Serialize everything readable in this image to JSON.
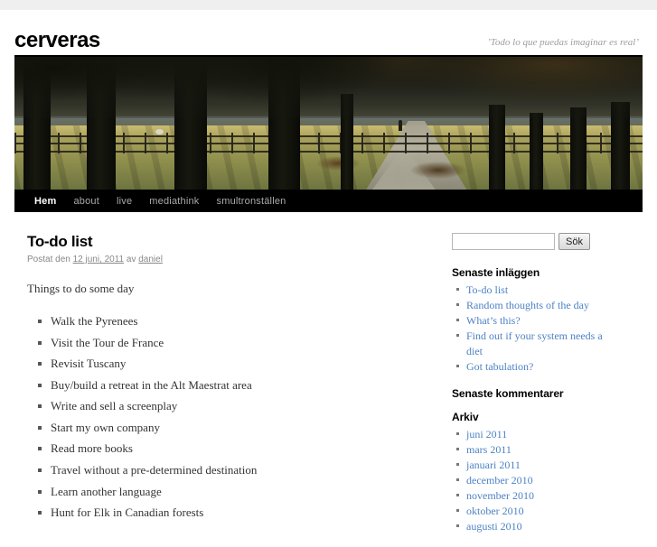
{
  "site": {
    "title": "cerveras",
    "description": "’Todo lo que puedas imaginar es real’"
  },
  "nav": {
    "items": [
      {
        "label": "Hem",
        "current": true
      },
      {
        "label": "about",
        "current": false
      },
      {
        "label": "live",
        "current": false
      },
      {
        "label": "mediathink",
        "current": false
      },
      {
        "label": "smultronställen",
        "current": false
      }
    ]
  },
  "post": {
    "title": "To-do list",
    "meta_prefix": "Postat den",
    "date": "12 juni, 2011",
    "meta_by": "av",
    "author": "daniel",
    "intro": "Things to do some day",
    "items": [
      "Walk the Pyrenees",
      "Visit the Tour de France",
      "Revisit Tuscany",
      "Buy/build a retreat in the Alt Maestrat area",
      "Write and sell a screenplay",
      "Start my own company",
      "Read more books",
      "Travel without a pre-determined destination",
      "Learn another language",
      "Hunt for Elk in Canadian forests"
    ]
  },
  "sidebar": {
    "search": {
      "value": "",
      "placeholder": "",
      "button_label": "Sök"
    },
    "recent_posts": {
      "title": "Senaste inläggen",
      "items": [
        "To-do list",
        "Random thoughts of the day",
        "What’s this?",
        "Find out if your system needs a diet",
        "Got tabulation?"
      ]
    },
    "recent_comments": {
      "title": "Senaste kommentarer",
      "items": []
    },
    "archives": {
      "title": "Arkiv",
      "items": [
        "juni 2011",
        "mars 2011",
        "januari 2011",
        "december 2010",
        "november 2010",
        "oktober 2010",
        "augusti 2010"
      ]
    }
  },
  "colors": {
    "link": "#4d82c4",
    "nav_bg": "#000000",
    "top_band": "#efefef",
    "meta_text": "#888888"
  }
}
